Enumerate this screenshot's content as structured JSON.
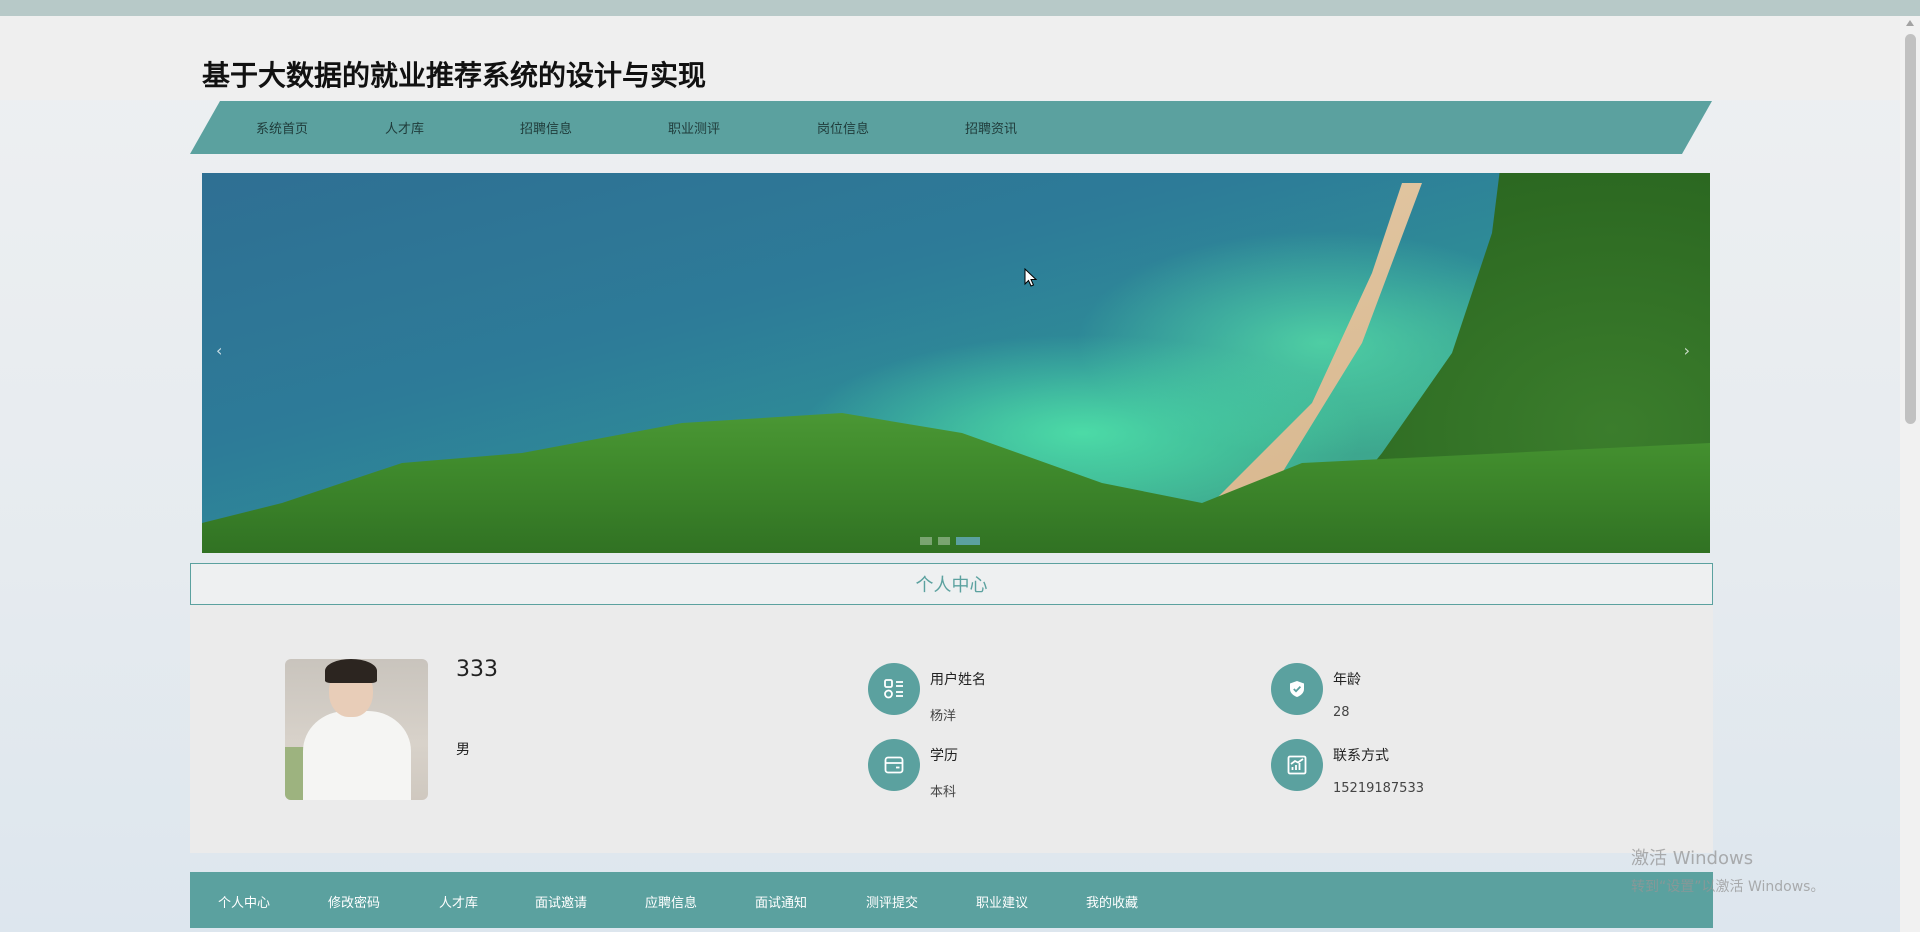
{
  "header": {
    "title": "基于大数据的就业推荐系统的设计与实现"
  },
  "nav": {
    "items": [
      "系统首页",
      "人才库",
      "招聘信息",
      "职业测评",
      "岗位信息",
      "招聘资讯"
    ]
  },
  "banner": {
    "prev": "‹",
    "next": "›",
    "slide_count": 3,
    "active_slide": 3
  },
  "section": {
    "title": "个人中心"
  },
  "profile": {
    "username": "333",
    "gender": "男",
    "fields": [
      {
        "label": "用户姓名",
        "value": "杨洋",
        "icon": "user-grid-icon"
      },
      {
        "label": "年龄",
        "value": "28",
        "icon": "shield-icon"
      },
      {
        "label": "学历",
        "value": "本科",
        "icon": "wallet-icon"
      },
      {
        "label": "联系方式",
        "value": "15219187533",
        "icon": "chart-icon"
      }
    ]
  },
  "bottom_nav": {
    "items": [
      "个人中心",
      "修改密码",
      "人才库",
      "面试邀请",
      "应聘信息",
      "面试通知",
      "测评提交",
      "职业建议",
      "我的收藏"
    ],
    "active": "个人中心"
  },
  "watermark": {
    "line1": "激活 Windows",
    "line2": "转到“设置”以激活 Windows。"
  },
  "colors": {
    "accent": "#5ba19f",
    "title": "#111111"
  }
}
